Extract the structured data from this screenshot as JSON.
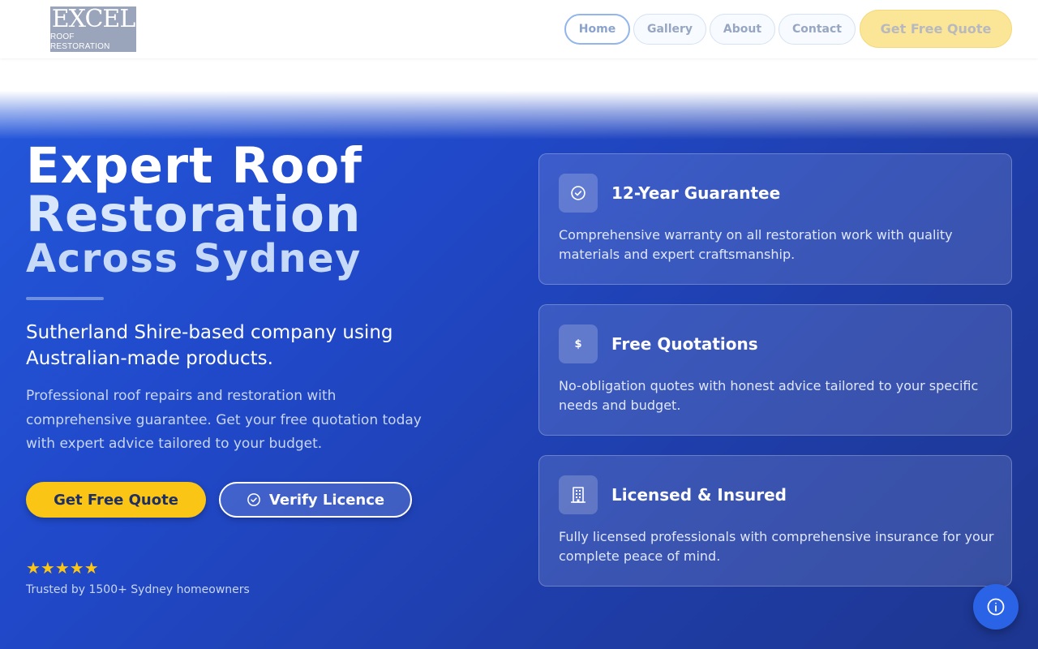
{
  "logo": {
    "main": "EXCEL",
    "sub": "ROOF RESTORATION"
  },
  "nav": {
    "items": [
      {
        "label": "Home",
        "active": true
      },
      {
        "label": "Gallery",
        "active": false
      },
      {
        "label": "About",
        "active": false
      },
      {
        "label": "Contact",
        "active": false
      }
    ],
    "cta_label": "Get Free Quote"
  },
  "hero": {
    "title_line1": "Expert Roof",
    "title_line2": "Restoration",
    "title_line3": "Across Sydney",
    "lead": "Sutherland Shire-based company using Australian-made products.",
    "description": "Professional roof repairs and restoration with comprehensive guarantee. Get your free quotation today with expert advice tailored to your budget.",
    "primary_button": "Get Free Quote",
    "secondary_button": "Verify Licence",
    "rating_stars": "★★★★★",
    "trust_text": "Trusted by 1500+ Sydney homeowners"
  },
  "features": [
    {
      "icon": "check-circle-icon",
      "title": "12-Year Guarantee",
      "text": "Comprehensive warranty on all restoration work with quality materials and expert craftsmanship."
    },
    {
      "icon": "dollar-icon",
      "icon_glyph": "$",
      "title": "Free Quotations",
      "text": "No-obligation quotes with honest advice tailored to your specific needs and budget."
    },
    {
      "icon": "building-icon",
      "title": "Licensed & Insured",
      "text": "Fully licensed professionals with comprehensive insurance for your complete peace of mind."
    }
  ],
  "floating_button": {
    "icon": "info-icon"
  },
  "colors": {
    "brand_blue": "#2048c8",
    "accent_yellow": "#fac515",
    "button_text": "#1e2f63"
  }
}
